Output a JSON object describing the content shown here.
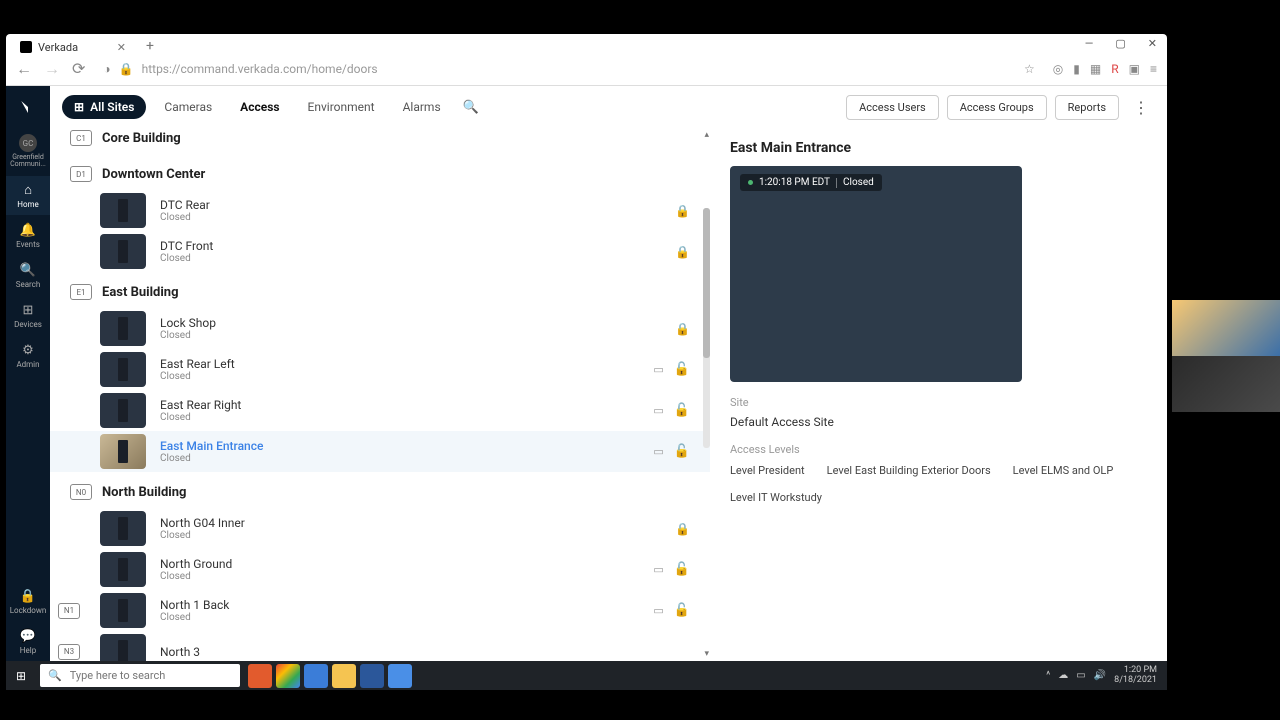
{
  "browser": {
    "tab_title": "Verkada",
    "url": "https://command.verkada.com/home/doors"
  },
  "rail": {
    "org": "Greenfield Communi...",
    "home": "Home",
    "events": "Events",
    "search": "Search",
    "devices": "Devices",
    "admin": "Admin",
    "lockdown": "Lockdown",
    "help": "Help"
  },
  "topnav": {
    "sites": "All Sites",
    "cameras": "Cameras",
    "access": "Access",
    "environment": "Environment",
    "alarms": "Alarms",
    "access_users": "Access Users",
    "access_groups": "Access Groups",
    "reports": "Reports"
  },
  "groups": [
    {
      "badge": "C1",
      "name": "Core Building",
      "cut": true,
      "doors": []
    },
    {
      "badge": "D1",
      "name": "Downtown Center",
      "doors": [
        {
          "name": "DTC Rear",
          "status": "Closed",
          "icons": [
            "lock"
          ]
        },
        {
          "name": "DTC Front",
          "status": "Closed",
          "icons": [
            "lock"
          ]
        }
      ]
    },
    {
      "badge": "E1",
      "name": "East Building",
      "doors": [
        {
          "name": "Lock Shop",
          "status": "Closed",
          "icons": [
            "lock"
          ]
        },
        {
          "name": "East Rear Left",
          "status": "Closed",
          "icons": [
            "card",
            "unlock"
          ]
        },
        {
          "name": "East Rear Right",
          "status": "Closed",
          "icons": [
            "card",
            "unlock"
          ]
        },
        {
          "name": "East Main Entrance",
          "status": "Closed",
          "icons": [
            "card",
            "unlock"
          ],
          "selected": true,
          "lightThumb": true
        }
      ]
    },
    {
      "badge": "N0",
      "name": "North Building",
      "doors": [
        {
          "name": "North G04 Inner",
          "status": "Closed",
          "icons": [
            "lock"
          ]
        },
        {
          "name": "North Ground",
          "status": "Closed",
          "icons": [
            "card",
            "unlock"
          ]
        },
        {
          "name": "North 1 Back",
          "status": "Closed",
          "icons": [
            "card",
            "unlock"
          ],
          "rowBadge": "N1"
        },
        {
          "name": "North 3",
          "status": "",
          "icons": [],
          "rowBadge": "N3"
        }
      ]
    }
  ],
  "details": {
    "title": "East Main Entrance",
    "time": "1:20:18 PM EDT",
    "state": "Closed",
    "site_label": "Site",
    "site_value": "Default Access Site",
    "levels_label": "Access Levels",
    "levels": [
      "Level President",
      "Level East Building Exterior Doors",
      "Level ELMS and OLP",
      "Level IT Workstudy"
    ]
  },
  "taskbar": {
    "search_placeholder": "Type here to search",
    "time": "1:20 PM",
    "date": "8/18/2021"
  }
}
